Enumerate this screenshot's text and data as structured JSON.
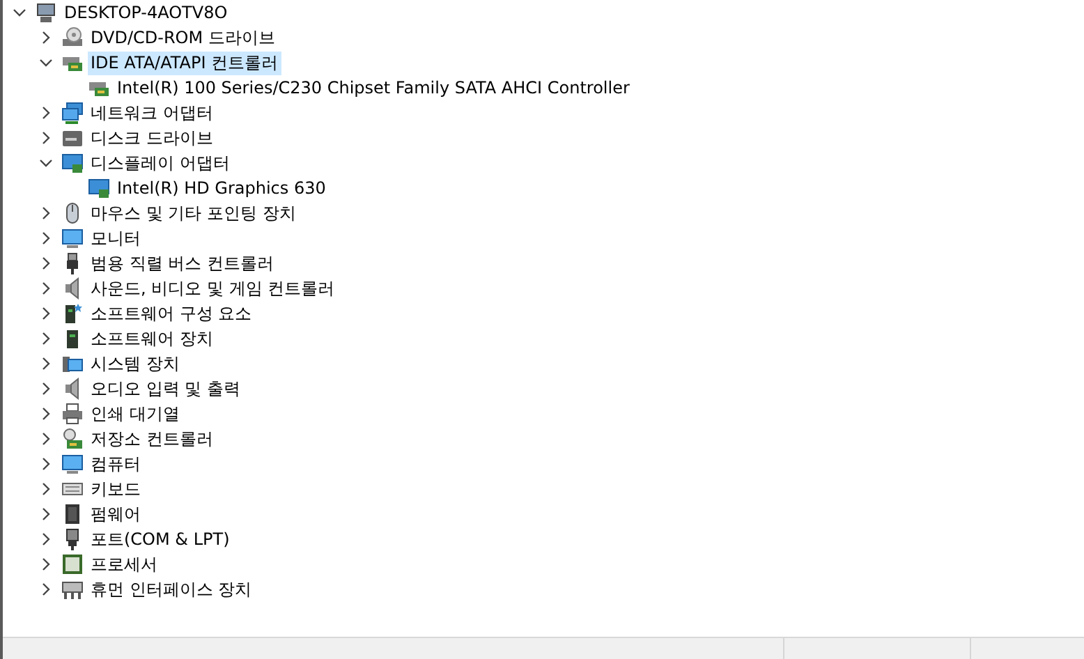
{
  "tree": [
    {
      "label": "DESKTOP-4AOTV8O",
      "kind": "pc",
      "expanded": true,
      "selected": false,
      "children": [
        {
          "label": "DVD/CD-ROM 드라이브",
          "kind": "disc",
          "expanded": false,
          "selected": false
        },
        {
          "label": "IDE ATA/ATAPI 컨트롤러",
          "kind": "controller",
          "expanded": true,
          "selected": true,
          "children": [
            {
              "label": "Intel(R) 100 Series/C230 Chipset Family SATA AHCI Controller",
              "kind": "controller",
              "selected": false
            }
          ]
        },
        {
          "label": "네트워크 어댑터",
          "kind": "network",
          "expanded": false,
          "selected": false
        },
        {
          "label": "디스크 드라이브",
          "kind": "disk",
          "expanded": false,
          "selected": false
        },
        {
          "label": "디스플레이 어댑터",
          "kind": "display",
          "expanded": true,
          "selected": false,
          "children": [
            {
              "label": "Intel(R) HD Graphics 630",
              "kind": "display",
              "selected": false
            }
          ]
        },
        {
          "label": "마우스 및 기타 포인팅 장치",
          "kind": "mouse",
          "expanded": false,
          "selected": false
        },
        {
          "label": "모니터",
          "kind": "monitor",
          "expanded": false,
          "selected": false
        },
        {
          "label": "범용 직렬 버스 컨트롤러",
          "kind": "usb",
          "expanded": false,
          "selected": false
        },
        {
          "label": "사운드, 비디오 및 게임 컨트롤러",
          "kind": "speaker",
          "expanded": false,
          "selected": false
        },
        {
          "label": "소프트웨어 구성 요소",
          "kind": "component",
          "expanded": false,
          "selected": false
        },
        {
          "label": "소프트웨어 장치",
          "kind": "device",
          "expanded": false,
          "selected": false
        },
        {
          "label": "시스템 장치",
          "kind": "system",
          "expanded": false,
          "selected": false
        },
        {
          "label": "오디오 입력 및 출력",
          "kind": "speaker",
          "expanded": false,
          "selected": false
        },
        {
          "label": "인쇄 대기열",
          "kind": "printer",
          "expanded": false,
          "selected": false
        },
        {
          "label": "저장소 컨트롤러",
          "kind": "storage",
          "expanded": false,
          "selected": false
        },
        {
          "label": "컴퓨터",
          "kind": "monitor",
          "expanded": false,
          "selected": false
        },
        {
          "label": "키보드",
          "kind": "keyboard",
          "expanded": false,
          "selected": false
        },
        {
          "label": "펌웨어",
          "kind": "chip",
          "expanded": false,
          "selected": false
        },
        {
          "label": "포트(COM & LPT)",
          "kind": "port",
          "expanded": false,
          "selected": false
        },
        {
          "label": "프로세서",
          "kind": "processor",
          "expanded": false,
          "selected": false
        },
        {
          "label": "휴먼 인터페이스 장치",
          "kind": "hid",
          "expanded": false,
          "selected": false
        }
      ]
    }
  ]
}
